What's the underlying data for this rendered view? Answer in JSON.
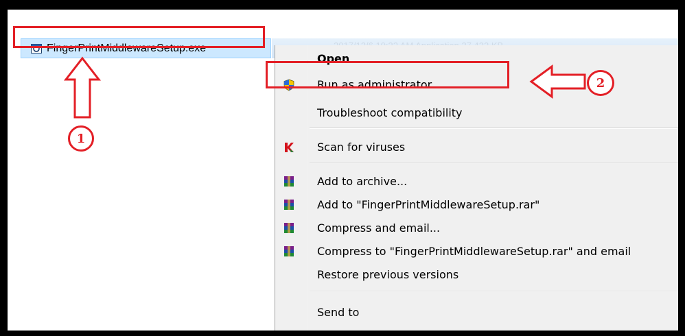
{
  "file": {
    "name": "FingerPrintMiddlewareSetup.exe",
    "icon": "installer-icon",
    "row_details": "2017/12/6 10:32 AM    Application    37,432 KB"
  },
  "menu": {
    "items": [
      {
        "id": "open",
        "label": "Open",
        "icon": null,
        "bold": true
      },
      {
        "id": "run-as-admin",
        "label": "Run as administrator",
        "icon": "uac-shield-icon",
        "bold": false
      },
      {
        "id": "troubleshoot",
        "label": "Troubleshoot compatibility",
        "icon": null,
        "bold": false
      },
      {
        "id": "scan",
        "label": "Scan for viruses",
        "icon": "kaspersky-icon",
        "bold": false
      },
      {
        "id": "add-archive",
        "label": "Add to archive...",
        "icon": "winrar-icon",
        "bold": false
      },
      {
        "id": "add-rar",
        "label": "Add to \"FingerPrintMiddlewareSetup.rar\"",
        "icon": "winrar-icon",
        "bold": false
      },
      {
        "id": "compress-email",
        "label": "Compress and email...",
        "icon": "winrar-icon",
        "bold": false
      },
      {
        "id": "compress-rar-email",
        "label": "Compress to \"FingerPrintMiddlewareSetup.rar\" and email",
        "icon": "winrar-icon",
        "bold": false
      },
      {
        "id": "restore",
        "label": "Restore previous versions",
        "icon": null,
        "bold": false
      },
      {
        "id": "send-to",
        "label": "Send to",
        "icon": null,
        "bold": false
      }
    ]
  },
  "annotations": {
    "step1": "1",
    "step2": "2",
    "color": "#e31f26"
  }
}
